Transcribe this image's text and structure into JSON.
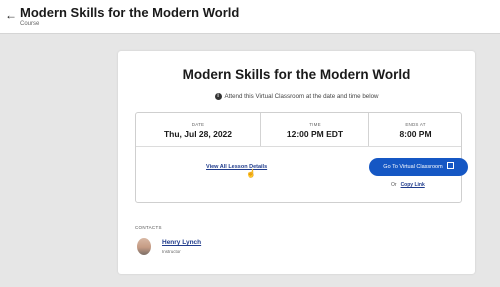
{
  "header": {
    "back_icon": "arrow-left-icon",
    "title": "Modern Skills for the Modern World",
    "subtitle": "Course"
  },
  "course": {
    "title": "Modern Skills for the Modern World",
    "attend_note": "Attend this Virtual Classroom at the date and time below",
    "info_icon": "info-icon"
  },
  "schedule": {
    "date_label": "DATE",
    "date_value": "Thu, Jul 28, 2022",
    "time_label": "TIME",
    "time_value": "12:00 PM EDT",
    "ends_label": "ENDS AT",
    "ends_value": "8:00 PM"
  },
  "actions": {
    "lesson_details_link": "View All Lesson Details",
    "virtual_classroom_button": "Go To Virtual Classroom",
    "external_icon": "external-link-icon",
    "or_text": "Or",
    "copy_link": "Copy Link"
  },
  "contacts": {
    "label": "CONTACTS",
    "items": [
      {
        "name": "Henry Lynch",
        "role": "Instructor"
      }
    ]
  },
  "colors": {
    "accent": "#1557c4",
    "link": "#1f3b8c",
    "background": "#e6e6e6"
  }
}
